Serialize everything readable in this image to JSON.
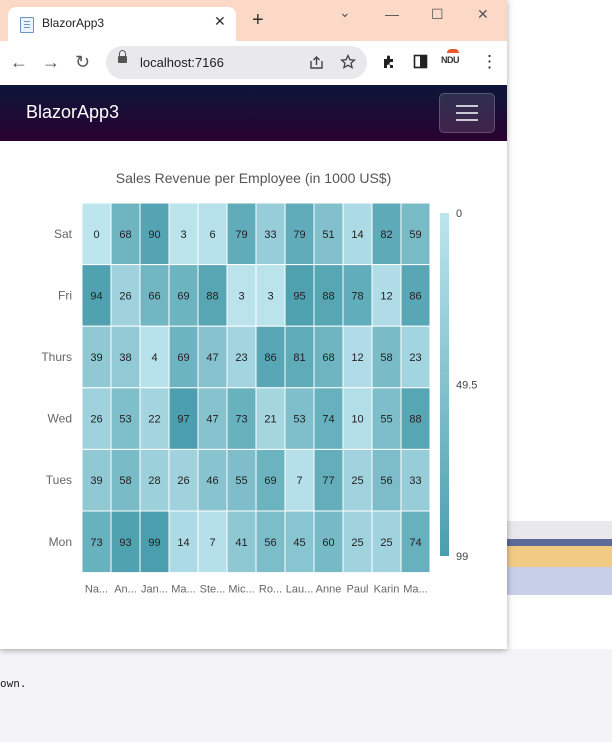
{
  "browser": {
    "tab_title": "BlazorApp3",
    "tab_close": "✕",
    "new_tab": "+",
    "url": "localhost:7166",
    "win_minimize": "⌄",
    "win_min": "—",
    "win_max": "☐",
    "win_close": "✕",
    "back": "←",
    "forward": "→",
    "reload": "↻",
    "ext_label": "NDU",
    "menu": "⋮"
  },
  "app": {
    "brand": "BlazorApp3"
  },
  "background": {
    "code_fragment": "own."
  },
  "chart_data": {
    "type": "heatmap",
    "title": "Sales Revenue per Employee (in 1000 US$)",
    "x_labels": [
      "Na...",
      "An...",
      "Jan...",
      "Ma...",
      "Ste...",
      "Mic...",
      "Ro...",
      "Lau...",
      "Anne",
      "Paul",
      "Karin",
      "Ma..."
    ],
    "y_labels": [
      "Sat",
      "Fri",
      "Thurs",
      "Wed",
      "Tues",
      "Mon"
    ],
    "values": [
      [
        0,
        68,
        90,
        3,
        6,
        79,
        33,
        79,
        51,
        14,
        82,
        59
      ],
      [
        94,
        26,
        66,
        69,
        88,
        3,
        3,
        95,
        88,
        78,
        12,
        86
      ],
      [
        39,
        38,
        4,
        69,
        47,
        23,
        86,
        81,
        68,
        12,
        58,
        23
      ],
      [
        26,
        53,
        22,
        97,
        47,
        73,
        21,
        53,
        74,
        10,
        55,
        88
      ],
      [
        39,
        58,
        28,
        26,
        46,
        55,
        69,
        7,
        77,
        25,
        56,
        33
      ],
      [
        73,
        93,
        99,
        14,
        7,
        41,
        56,
        45,
        60,
        25,
        25,
        74
      ]
    ],
    "color_min": "#bde5ee",
    "color_max": "#4a9ead",
    "legend": {
      "labels": [
        "0",
        "49.5",
        "99"
      ],
      "min": 0,
      "mid": 49.5,
      "max": 99,
      "placement": "right"
    }
  }
}
